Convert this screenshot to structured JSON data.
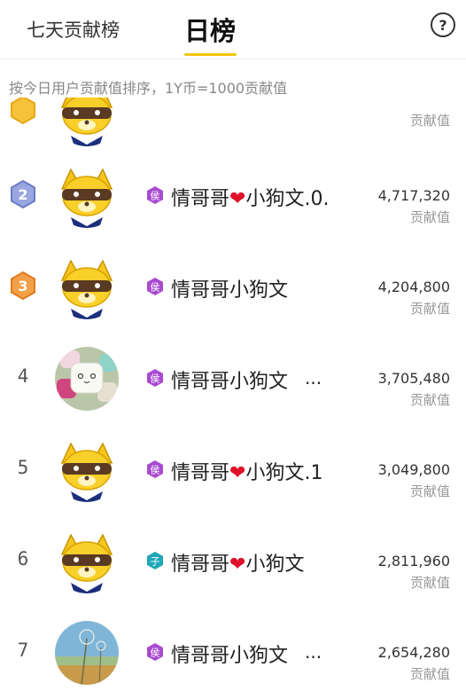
{
  "tabs": {
    "week": "七天贡献榜",
    "day": "日榜",
    "help_symbol": "?"
  },
  "subtitle": "按今日用户贡献值排序，1Y币=1000贡献值",
  "score_unit": "贡献值",
  "rows": [
    {
      "rank": "2",
      "name_a": "情哥哥",
      "heart": "❤",
      "name_b": "小狗文.0.",
      "ellipsis": "",
      "level": "侯",
      "level_color": "#a94bd1",
      "score": "4,717,320",
      "avatar": "raccoon"
    },
    {
      "rank": "3",
      "name_a": "情哥哥小狗文",
      "heart": "",
      "name_b": "",
      "ellipsis": "",
      "level": "侯",
      "level_color": "#a94bd1",
      "score": "4,204,800",
      "avatar": "raccoon"
    },
    {
      "rank": "4",
      "name_a": "情哥哥小狗文",
      "heart": "",
      "name_b": "",
      "ellipsis": "...",
      "level": "侯",
      "level_color": "#a94bd1",
      "score": "3,705,480",
      "avatar": "marshmallow"
    },
    {
      "rank": "5",
      "name_a": "情哥哥",
      "heart": "❤",
      "name_b": "小狗文.1",
      "ellipsis": "",
      "level": "侯",
      "level_color": "#a94bd1",
      "score": "3,049,800",
      "avatar": "raccoon"
    },
    {
      "rank": "6",
      "name_a": "情哥哥",
      "heart": "❤",
      "name_b": "小狗文",
      "ellipsis": "",
      "level": "子",
      "level_color": "#1fa7b8",
      "score": "2,811,960",
      "avatar": "raccoon"
    },
    {
      "rank": "7",
      "name_a": "情哥哥小狗文",
      "heart": "",
      "name_b": "",
      "ellipsis": "...",
      "level": "侯",
      "level_color": "#a94bd1",
      "score": "2,654,280",
      "avatar": "dandelion"
    }
  ]
}
